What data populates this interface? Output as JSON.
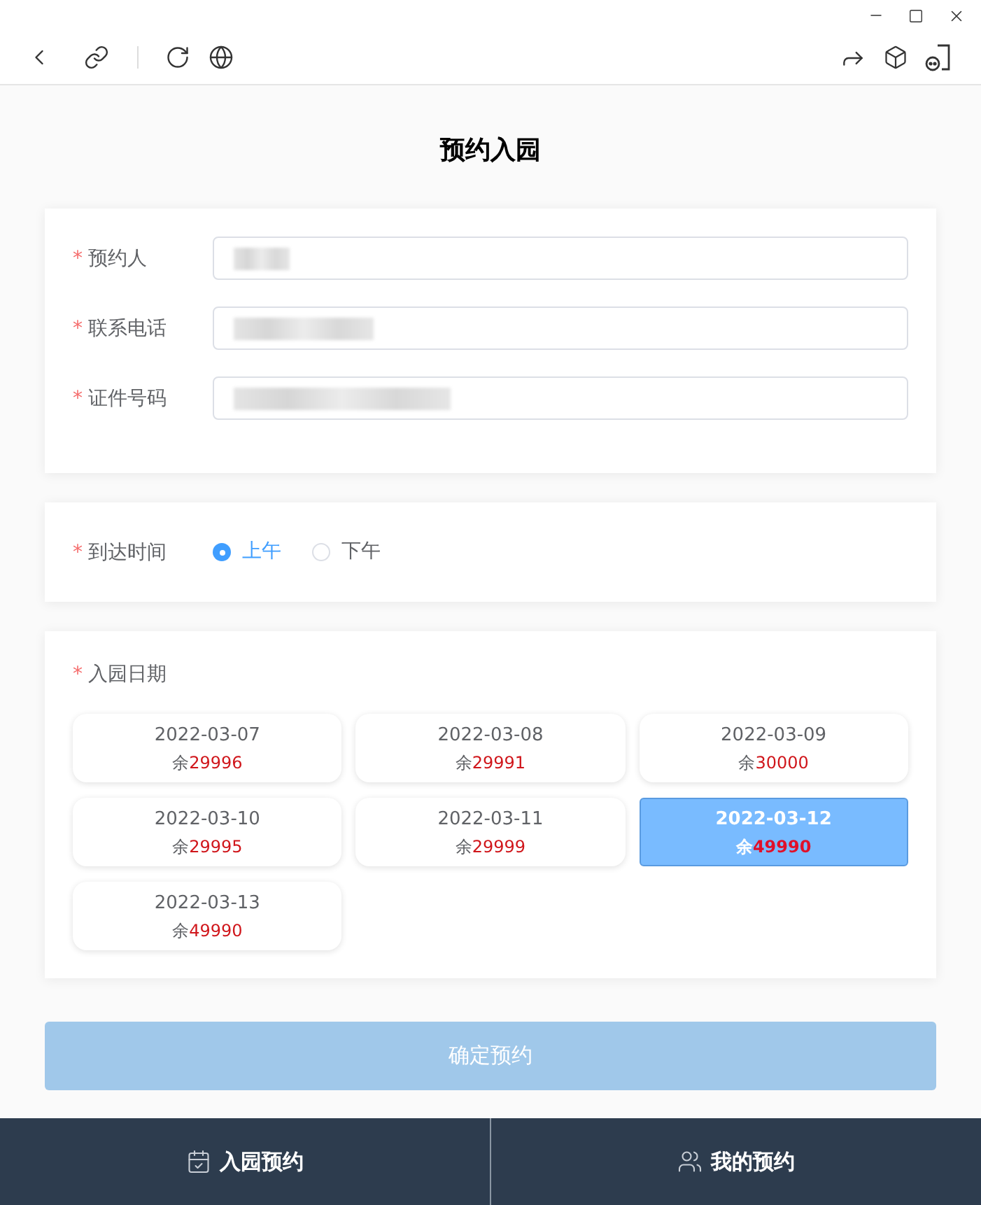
{
  "page": {
    "title": "预约入园"
  },
  "applicant_form": {
    "fields": [
      {
        "required_mark": "*",
        "label": "预约人",
        "redacted": true
      },
      {
        "required_mark": "*",
        "label": "联系电话",
        "redacted": true
      },
      {
        "required_mark": "*",
        "label": "证件号码",
        "redacted": true
      }
    ]
  },
  "arrival_time": {
    "required_mark": "*",
    "label": "到达时间",
    "options": [
      {
        "label": "上午",
        "selected": true
      },
      {
        "label": "下午",
        "selected": false
      }
    ]
  },
  "visit_date": {
    "required_mark": "*",
    "label": "入园日期",
    "dates": [
      {
        "date": "2022-03-07",
        "prefix": "余",
        "remaining": "29996",
        "selected": false
      },
      {
        "date": "2022-03-08",
        "prefix": "余",
        "remaining": "29991",
        "selected": false
      },
      {
        "date": "2022-03-09",
        "prefix": "余",
        "remaining": "30000",
        "selected": false
      },
      {
        "date": "2022-03-10",
        "prefix": "余",
        "remaining": "29995",
        "selected": false
      },
      {
        "date": "2022-03-11",
        "prefix": "余",
        "remaining": "29999",
        "selected": false
      },
      {
        "date": "2022-03-12",
        "prefix": "余",
        "remaining": "49990",
        "selected": true
      },
      {
        "date": "2022-03-13",
        "prefix": "余",
        "remaining": "49990",
        "selected": false
      }
    ]
  },
  "submit_button": {
    "label": "确定预约",
    "disabled": true
  },
  "bottom_nav": [
    {
      "label": "入园预约"
    },
    {
      "label": "我的预约"
    }
  ]
}
